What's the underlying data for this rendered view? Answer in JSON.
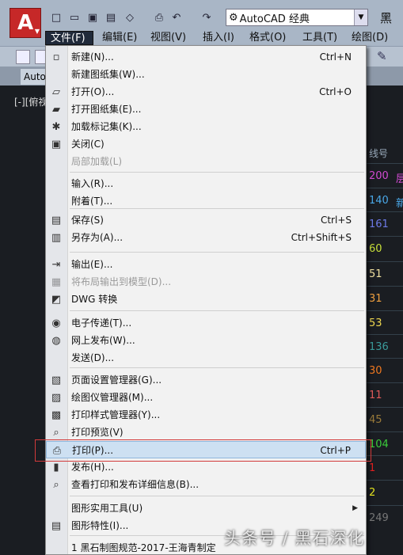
{
  "app": {
    "logo": "A",
    "workspace": "AutoCAD 经典",
    "title_truncated": "黑",
    "viewport_label": "[-][俯视",
    "tab_label": "Auto"
  },
  "menubar": [
    {
      "label": "文件(F)",
      "active": true
    },
    {
      "label": "编辑(E)"
    },
    {
      "label": "视图(V)"
    },
    {
      "label": "插入(I)"
    },
    {
      "label": "格式(O)"
    },
    {
      "label": "工具(T)"
    },
    {
      "label": "绘图(D)"
    }
  ],
  "file_menu": [
    {
      "label": "新建(N)...",
      "shortcut": "Ctrl+N",
      "icon": "new-file-icon"
    },
    {
      "label": "新建图纸集(W)...",
      "icon": ""
    },
    {
      "label": "打开(O)...",
      "shortcut": "Ctrl+O",
      "icon": "open-folder-icon"
    },
    {
      "label": "打开图纸集(E)...",
      "icon": "open-sheetset-icon"
    },
    {
      "label": "加载标记集(K)...",
      "icon": "markup-icon"
    },
    {
      "label": "关闭(C)",
      "icon": "close-file-icon"
    },
    {
      "label": "局部加载(L)",
      "disabled": true,
      "icon": ""
    },
    {
      "label": "输入(R)...",
      "icon": ""
    },
    {
      "label": "附着(T)...",
      "icon": ""
    },
    {
      "label": "保存(S)",
      "shortcut": "Ctrl+S",
      "icon": "save-icon"
    },
    {
      "label": "另存为(A)...",
      "shortcut": "Ctrl+Shift+S",
      "icon": "save-as-icon"
    },
    {
      "label": "输出(E)...",
      "icon": "export-icon"
    },
    {
      "label": "将布局输出到模型(D)...",
      "disabled": true,
      "icon": "layout-export-icon"
    },
    {
      "label": "DWG 转换",
      "icon": "dwg-convert-icon"
    },
    {
      "label": "电子传递(T)...",
      "icon": "etransmit-icon"
    },
    {
      "label": "网上发布(W)...",
      "icon": "publish-web-icon"
    },
    {
      "label": "发送(D)...",
      "icon": ""
    },
    {
      "label": "页面设置管理器(G)...",
      "icon": "page-setup-icon"
    },
    {
      "label": "绘图仪管理器(M)...",
      "icon": "plotter-icon"
    },
    {
      "label": "打印样式管理器(Y)...",
      "icon": "plot-style-icon"
    },
    {
      "label": "打印预览(V)",
      "icon": "plot-preview-icon"
    },
    {
      "label": "打印(P)...",
      "shortcut": "Ctrl+P",
      "icon": "printer-icon",
      "highlight": true
    },
    {
      "label": "发布(H)...",
      "icon": "publish-icon"
    },
    {
      "label": "查看打印和发布详细信息(B)...",
      "icon": "plot-details-icon"
    },
    {
      "label": "图形实用工具(U)",
      "submenu": true,
      "icon": ""
    },
    {
      "label": "图形特性(I)...",
      "icon": "drawing-props-icon"
    },
    {
      "label": "1 黑石制图规范-2017-王海青制定",
      "icon": ""
    }
  ],
  "layers": {
    "header": "线号",
    "rows": [
      {
        "num": "200",
        "color": "#d24bd2",
        "right": "层",
        "right_color": "#d24bd2"
      },
      {
        "num": "140",
        "color": "#4aa8e8",
        "right": "新",
        "right_color": "#4aa8e8"
      },
      {
        "num": "161",
        "color": "#6d7ae8"
      },
      {
        "num": "60",
        "color": "#c8e03a"
      },
      {
        "num": "51",
        "color": "#f0e0a0"
      },
      {
        "num": "31",
        "color": "#f0a040"
      },
      {
        "num": "53",
        "color": "#f0d850"
      },
      {
        "num": "136",
        "color": "#3a9a9a"
      },
      {
        "num": "30",
        "color": "#f07820"
      },
      {
        "num": "11",
        "color": "#e05a5a"
      },
      {
        "num": "45",
        "color": "#9a7a3a"
      },
      {
        "num": "104",
        "color": "#3acc3a"
      },
      {
        "num": "1",
        "color": "#e02020"
      },
      {
        "num": "2",
        "color": "#e8e820"
      },
      {
        "num": "249",
        "color": "#777777"
      }
    ]
  },
  "watermark": "头条号 / 黑石深化"
}
